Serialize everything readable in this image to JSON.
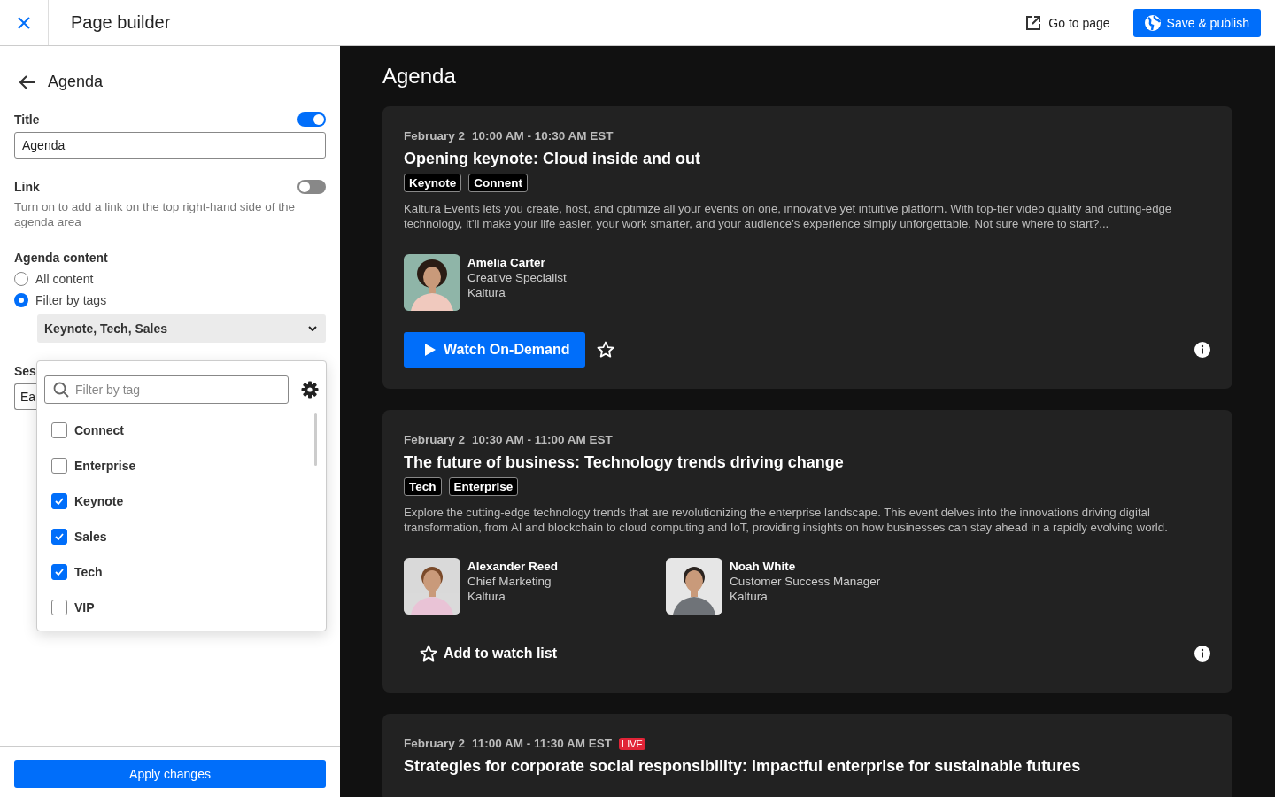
{
  "topbar": {
    "title": "Page builder",
    "go_to_page": "Go to page",
    "save_publish": "Save & publish"
  },
  "sidebar": {
    "heading": "Agenda",
    "title_field": {
      "label": "Title",
      "on": true,
      "value": "Agenda"
    },
    "link_field": {
      "label": "Link",
      "on": false,
      "help": "Turn on to add a link on the top right-hand side of the agenda area"
    },
    "agenda_content": {
      "label": "Agenda content",
      "options": [
        {
          "label": "All content",
          "selected": false
        },
        {
          "label": "Filter by tags",
          "selected": true
        }
      ],
      "tags_value": "Keynote, Tech, Sales"
    },
    "sessions_label": "Ses",
    "sessions_value": "Ea",
    "tag_dropdown": {
      "placeholder": "Filter by tag",
      "tags": [
        {
          "label": "Connect",
          "checked": false
        },
        {
          "label": "Enterprise",
          "checked": false
        },
        {
          "label": "Keynote",
          "checked": true
        },
        {
          "label": "Sales",
          "checked": true
        },
        {
          "label": "Tech",
          "checked": true
        },
        {
          "label": "VIP",
          "checked": false
        }
      ]
    },
    "apply": "Apply changes"
  },
  "main": {
    "heading": "Agenda",
    "sessions": [
      {
        "date": "February 2",
        "time": "10:00 AM - 10:30 AM EST",
        "title": "Opening keynote: Cloud inside and out",
        "tags": [
          "Keynote",
          "Connent"
        ],
        "description": "Kaltura Events lets you create, host, and optimize all your events on one, innovative yet intuitive platform. With top-tier video quality and cutting-edge technology, it’ll make your life easier, your work smarter, and your audience’s experience simply unforgettable. Not sure where to start?...",
        "speakers": [
          {
            "name": "Amelia Carter",
            "role": "Creative Specialist",
            "company": "Kaltura"
          }
        ],
        "action": {
          "kind": "watch",
          "label": "Watch On-Demand"
        }
      },
      {
        "date": "February 2",
        "time": "10:30 AM - 11:00 AM EST",
        "title": "The future of business: Technology trends driving change",
        "tags": [
          "Tech",
          "Enterprise"
        ],
        "description": "Explore the cutting-edge technology trends that are revolutionizing the enterprise landscape. This event delves into the innovations driving digital transformation, from AI and blockchain to cloud computing and IoT, providing insights on how businesses can stay ahead in a rapidly evolving world.",
        "speakers": [
          {
            "name": "Alexander Reed",
            "role": "Chief Marketing",
            "company": "Kaltura"
          },
          {
            "name": "Noah White",
            "role": "Customer Success Manager",
            "company": "Kaltura"
          }
        ],
        "action": {
          "kind": "watchlist",
          "label": "Add to watch list"
        }
      },
      {
        "date": "February 2",
        "time": "11:00 AM - 11:30 AM EST",
        "live": "LIVE",
        "title": "Strategies for corporate social responsibility: impactful enterprise for sustainable futures"
      }
    ]
  }
}
